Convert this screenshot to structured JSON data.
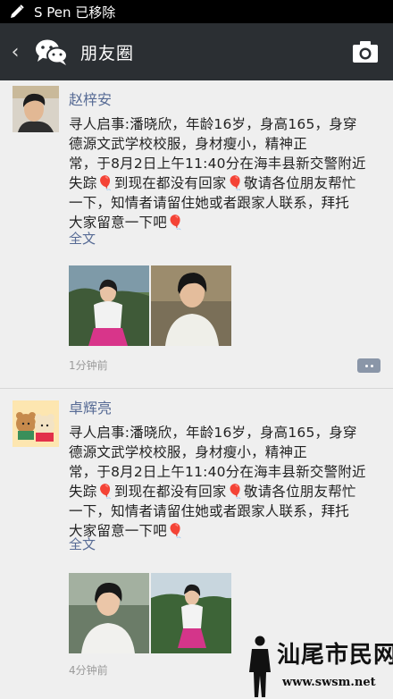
{
  "status_bar": {
    "notification": "S Pen 已移除"
  },
  "app_bar": {
    "back": "‹",
    "title": "朋友圈"
  },
  "posts": [
    {
      "author": "赵梓安",
      "lines": [
        "寻人启事:潘晓欣，年龄16岁，身高165，身穿",
        "德源文武学校校服，身材瘦小，精神正",
        "常，于8月2日上午11:40分在海丰县新交警附近",
        "失踪🎈到现在都没有回家🎈敬请各位朋友帮忙",
        "一下，知情者请留住她或者跟家人联系，拜托",
        "大家留意一下吧🎈"
      ],
      "full_text": "全文",
      "time": "1分钟前"
    },
    {
      "author": "卓辉亮",
      "lines": [
        "寻人启事:潘晓欣，年龄16岁，身高165，身穿",
        "德源文武学校校服，身材瘦小，精神正",
        "常，于8月2日上午11:40分在海丰县新交警附近",
        "失踪🎈到现在都没有回家🎈敬请各位朋友帮忙",
        "一下，知情者请留住她或者跟家人联系，拜托",
        "大家留意一下吧🎈"
      ],
      "full_text": "全文",
      "time": "4分钟前"
    }
  ],
  "watermark": {
    "site_name": "汕尾市民网",
    "url": "www.swsm.net"
  },
  "colors": {
    "link_blue": "#576b95",
    "app_bar": "#2b2f33"
  }
}
